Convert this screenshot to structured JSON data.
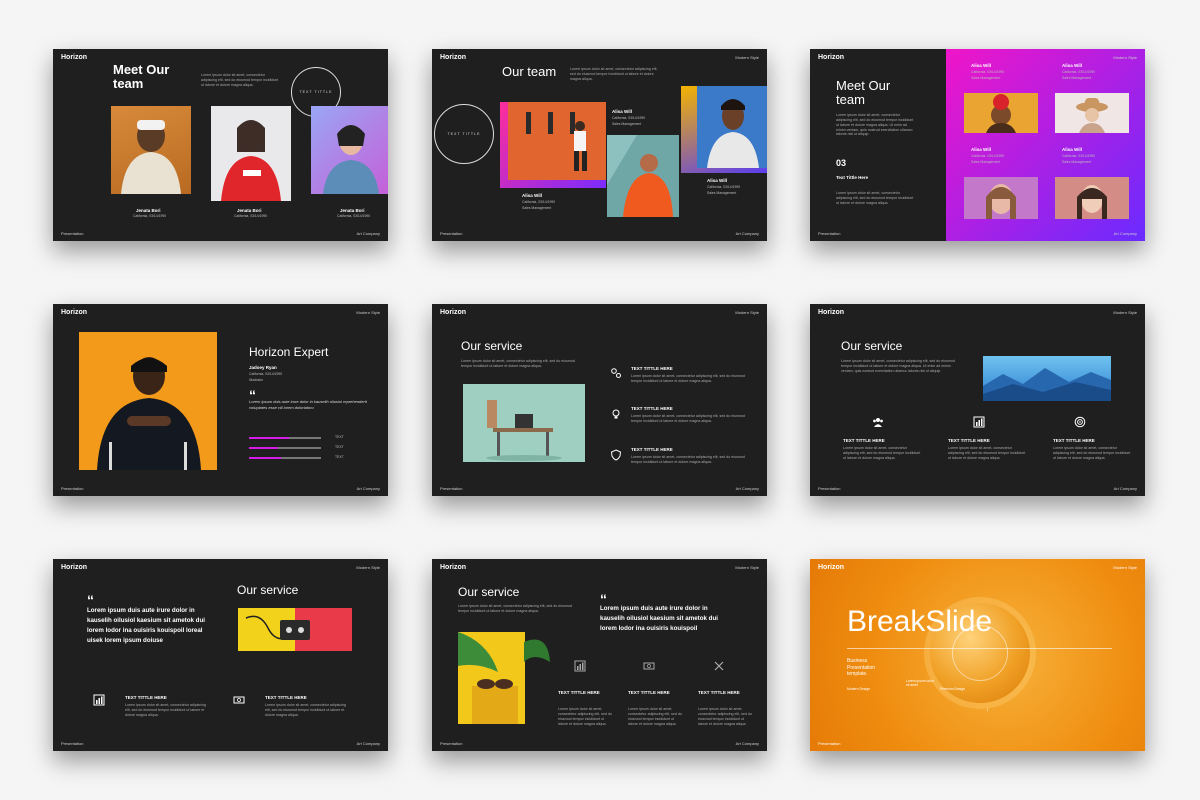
{
  "common": {
    "brand": "Horizon",
    "tag": "Modern Style",
    "footer_left": "Presentation",
    "footer_right": "Art Company",
    "lorem_short": "Lorem ipsum dolor sit amet, consectetur adipiscing elit, sed do eiusmod tempor incididunt ut labore et dolore magna aliqua.",
    "lorem_long": "Lorem ipsum dolor sit amet, consectetur adipiscing elit, sed do eiusmod tempor incididunt ut labore et dolore magna aliqua. Ut enim ad minim veniam, quis nostrud exercitation ullamco laboris nisi ut aliquip."
  },
  "slide1": {
    "title": "Meet Our team",
    "circle_text": "TEXT TITTLE",
    "members": [
      {
        "name": "Jenata Bori",
        "info": "California, 03/14/1990"
      },
      {
        "name": "Jenata Bori",
        "info": "California, 03/14/1990"
      },
      {
        "name": "Jenata Bori",
        "info": "California, 03/14/1990"
      }
    ]
  },
  "slide2": {
    "title": "Our team",
    "circle_text": "TEXT TITTLE",
    "members": [
      {
        "name": "Alisa Will",
        "info": "California, 03/14/1990",
        "role": "Sales Management"
      },
      {
        "name": "Alisa Will",
        "info": "California, 03/14/1990",
        "role": "Sales Management"
      },
      {
        "name": "Alisa Will",
        "info": "California, 03/14/1990",
        "role": "Sales Management"
      }
    ]
  },
  "slide3": {
    "title": "Meet Our team",
    "number": "03",
    "subtitle": "Text Tittle Here",
    "members": [
      {
        "name": "Alisa Will",
        "info": "California, 03/14/1990",
        "role": "Sales Management"
      },
      {
        "name": "Alisa Will",
        "info": "California, 03/14/1990",
        "role": "Sales Management"
      },
      {
        "name": "Alisa Will",
        "info": "California, 03/14/1990",
        "role": "Sales Management"
      },
      {
        "name": "Alisa Will",
        "info": "California, 03/14/1990",
        "role": "Sales Management"
      }
    ]
  },
  "slide4": {
    "title": "Horizon Expert",
    "name": "Jadoey Ryan",
    "info": "California, 03/14/1990",
    "role": "Illustrator",
    "quote": "Lorem ipsum duis aute irure dolor in kauselih oilusiol reprehenderit voluptates esse cill lorem doloriatoru",
    "skills": [
      {
        "label": "TEXT",
        "level": 0.55
      },
      {
        "label": "TEXT",
        "level": 0.4
      },
      {
        "label": "TEXT",
        "level": 0.45
      }
    ]
  },
  "slide5": {
    "title": "Our service",
    "items": [
      {
        "title": "TEXT TITTLE HERE",
        "icon": "gears-icon"
      },
      {
        "title": "TEXT TITTLE HERE",
        "icon": "bulb-icon"
      },
      {
        "title": "TEXT TITTLE HERE",
        "icon": "shield-icon"
      }
    ]
  },
  "slide6": {
    "title": "Our service",
    "items": [
      {
        "title": "TEXT TITTLE HERE",
        "icon": "team-icon"
      },
      {
        "title": "TEXT TITTLE HERE",
        "icon": "chart-icon"
      },
      {
        "title": "TEXT TITTLE HERE",
        "icon": "target-icon"
      }
    ]
  },
  "slide7": {
    "title": "Our service",
    "quote": "Lorem ipsum duis aute irure dolor in kauselih oilusiol kaesium sit ametok dui lorem lodor ina ouisiris kouispoil loreal uisek lorem ipsum doiuse",
    "items": [
      {
        "title": "TEXT TITTLE HERE",
        "icon": "chart-icon"
      },
      {
        "title": "TEXT TITTLE HERE",
        "icon": "money-icon"
      }
    ]
  },
  "slide8": {
    "title": "Our service",
    "quote": "Lorem ipsum duis aute irure dolor in kauselih oilusiol kaesium sit ametok dui lorem lodor ina ouisiris kouispoil",
    "items": [
      {
        "title": "TEXT TITTLE HERE",
        "icon": "chart-icon"
      },
      {
        "title": "TEXT TITTLE HERE",
        "icon": "money-icon"
      },
      {
        "title": "TEXT TITTLE HERE",
        "icon": "tools-icon"
      }
    ]
  },
  "slide9": {
    "title": "BreakSlide",
    "subtitle": "Business Presentation template.",
    "meta_left": "Modern Design",
    "meta_mid": "Lorem ipsum dolor sit amet",
    "meta_right": "Premium Design"
  },
  "colors": {
    "slide_bg": "#1f1f1f",
    "accent_pink": "#d41ce6",
    "accent_purple": "#6a2bff",
    "accent_orange": "#f2941b",
    "page_bg": "#f5f5f5"
  }
}
